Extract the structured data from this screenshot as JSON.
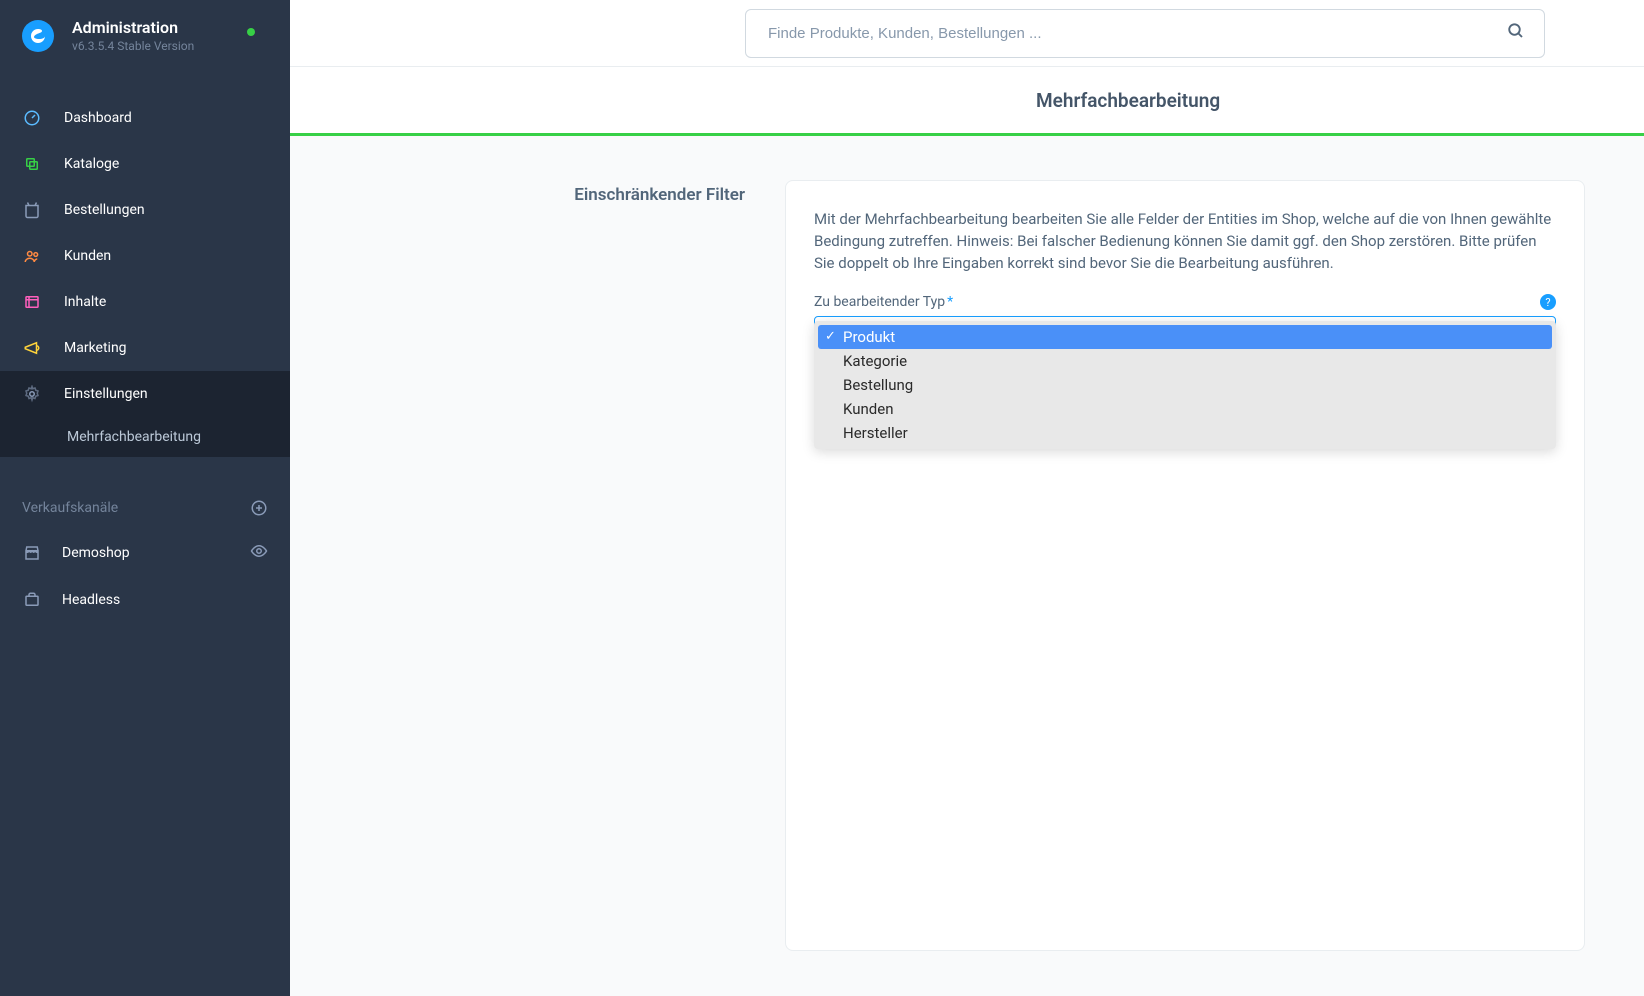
{
  "header": {
    "title": "Administration",
    "version": "v6.3.5.4 Stable Version"
  },
  "sidebar": {
    "items": [
      {
        "label": "Dashboard",
        "icon_color": "#5bbbff"
      },
      {
        "label": "Kataloge",
        "icon_color": "#37d046"
      },
      {
        "label": "Bestellungen",
        "icon_color": "#8a9bb8"
      },
      {
        "label": "Kunden",
        "icon_color": "#ff8a42"
      },
      {
        "label": "Inhalte",
        "icon_color": "#ff5fbd"
      },
      {
        "label": "Marketing",
        "icon_color": "#ffd43b"
      },
      {
        "label": "Einstellungen",
        "icon_color": "#8a9bb8"
      }
    ],
    "sub_item_label": "Mehrfachbearbeitung",
    "section_title": "Verkaufskanäle",
    "channels": [
      {
        "label": "Demoshop"
      },
      {
        "label": "Headless"
      }
    ]
  },
  "search": {
    "placeholder": "Finde Produkte, Kunden, Bestellungen ..."
  },
  "page": {
    "title": "Mehrfachbearbeitung",
    "filter_section_label": "Einschränkender Filter",
    "description": "Mit der Mehrfachbearbeitung bearbeiten Sie alle Felder der Entities im Shop, welche auf die von Ihnen gewählte Bedingung zutreffen. Hinweis: Bei falscher Bedienung können Sie damit ggf. den Shop zerstören. Bitte prüfen Sie doppelt ob Ihre Eingaben korrekt sind bevor Sie die Bearbeitung ausführen.",
    "field_label": "Zu bearbeitender Typ",
    "help_mark": "?",
    "dropdown_options": [
      "Produkt",
      "Kategorie",
      "Bestellung",
      "Kunden",
      "Hersteller"
    ]
  }
}
